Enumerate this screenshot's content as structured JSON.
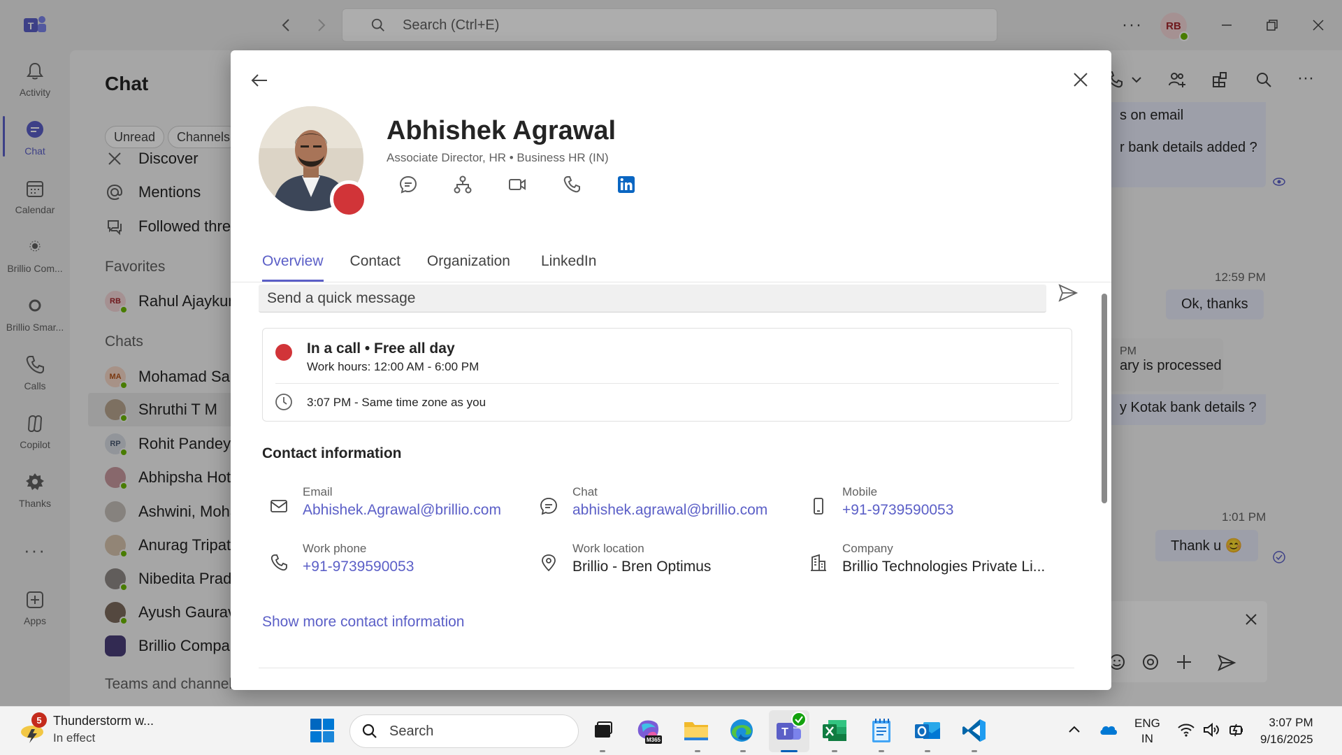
{
  "teams": {
    "search_placeholder": "Search (Ctrl+E)",
    "user_initials": "RB",
    "rail": [
      {
        "label": "Activity",
        "icon": "bell-icon"
      },
      {
        "label": "Chat",
        "icon": "chat-icon"
      },
      {
        "label": "Calendar",
        "icon": "calendar-icon"
      },
      {
        "label": "Brillio Com...",
        "icon": "brillio-app-icon"
      },
      {
        "label": "Brillio Smar...",
        "icon": "brillio-smart-icon"
      },
      {
        "label": "Calls",
        "icon": "phone-icon"
      },
      {
        "label": "Copilot",
        "icon": "copilot-icon"
      },
      {
        "label": "Thanks",
        "icon": "thanks-icon"
      },
      {
        "label": "Apps",
        "icon": "apps-icon"
      }
    ],
    "chatlist": {
      "title": "Chat",
      "filters": [
        "Unread",
        "Channels"
      ],
      "quick_links": [
        "Discover",
        "Mentions",
        "Followed threa"
      ],
      "favorites_label": "Favorites",
      "favorites": [
        {
          "name": "Rahul Ajaykum",
          "initials": "RB"
        }
      ],
      "chats_label": "Chats",
      "chats": [
        {
          "name": "Mohamad Salr",
          "initials": "MA"
        },
        {
          "name": "Shruthi T M",
          "initials": ""
        },
        {
          "name": "Rohit Pandey",
          "initials": "RP"
        },
        {
          "name": "Abhipsha Hota",
          "initials": ""
        },
        {
          "name": "Ashwini, Moha",
          "initials": ""
        },
        {
          "name": "Anurag Tripath",
          "initials": ""
        },
        {
          "name": "Nibedita Pradh",
          "initials": ""
        },
        {
          "name": "Ayush Gaurav",
          "initials": ""
        },
        {
          "name": "Brillio Compar",
          "initials": ""
        }
      ],
      "teams_label": "Teams and channels"
    },
    "messages": {
      "m1": "s on email",
      "m2": "r bank details added ?",
      "time1": "12:59 PM",
      "m3": "Ok, thanks",
      "m4_time": "PM",
      "m4": "ary is processed",
      "m5": "y Kotak bank details ?",
      "time2": "1:01 PM",
      "m6": "Thank u 😊"
    }
  },
  "profile": {
    "name": "Abhishek Agrawal",
    "role": "Associate Director, HR • Business HR (IN)",
    "tabs": [
      "Overview",
      "Contact",
      "Organization",
      "LinkedIn"
    ],
    "quick_message_placeholder": "Send a quick message",
    "status_main": "In a call • Free all day",
    "work_hours": "Work hours: 12:00 AM - 6:00 PM",
    "local_time": "3:07 PM - Same time zone as you",
    "contact_title": "Contact information",
    "contact": {
      "email_label": "Email",
      "email": "Abhishek.Agrawal@brillio.com",
      "chat_label": "Chat",
      "chat": "abhishek.agrawal@brillio.com",
      "mobile_label": "Mobile",
      "mobile": "+91-9739590053",
      "workphone_label": "Work phone",
      "workphone": "+91-9739590053",
      "location_label": "Work location",
      "location": "Brillio - Bren Optimus",
      "company_label": "Company",
      "company": "Brillio Technologies Private Li..."
    },
    "show_more": "Show more contact information",
    "colors": {
      "accent": "#5b5fc7",
      "busy": "#d13438",
      "available": "#6bb700"
    }
  },
  "taskbar": {
    "weather_badge": "5",
    "weather_title": "Thunderstorm w...",
    "weather_sub": "In effect",
    "search": "Search",
    "lang1": "ENG",
    "lang2": "IN",
    "time": "3:07 PM",
    "date": "9/16/2025",
    "m365_label": "M365"
  }
}
